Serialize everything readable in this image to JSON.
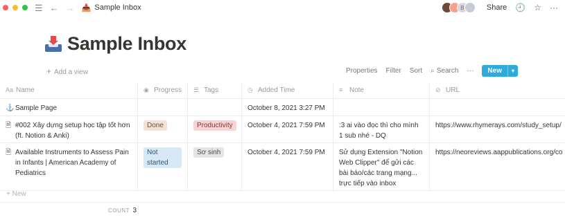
{
  "window": {
    "breadcrumb": "Sample Inbox"
  },
  "topbar": {
    "share_label": "Share",
    "avatar_initial": "B"
  },
  "page": {
    "title": "Sample Inbox"
  },
  "toolbar": {
    "add_view": "Add a view",
    "properties": "Properties",
    "filter": "Filter",
    "sort": "Sort",
    "search": "Search",
    "more": "···",
    "new_label": "New"
  },
  "table": {
    "columns": [
      "Name",
      "Progress",
      "Tags",
      "Added Time",
      "Note",
      "URL"
    ],
    "rows": [
      {
        "name": "Sample Page",
        "progress": "",
        "tag": "",
        "added": "October 8, 2021 3:27 PM",
        "note": "",
        "url": ""
      },
      {
        "name": "#002 Xây dựng setup học tập tốt hơn (ft. Notion & Anki)",
        "progress": "Done",
        "tag": "Productivity",
        "added": "October 4, 2021 7:59 PM",
        "note": ":3 ai vào đọc thì cho mình 1 sub nhé - DQ",
        "url": "https://www.rhymerays.com/study_setup/"
      },
      {
        "name": "Available Instruments to Assess Pain in Infants | American Academy of Pediatrics",
        "progress": "Not started",
        "tag": "Sơ sinh",
        "added": "October 4, 2021 7:59 PM",
        "note": "Sử dụng Extension \"Notion Web Clipper\" để gửi các bài báo/các trang mạng... trực tiếp vào inbox",
        "url": "https://neoreviews.aappublications.org/co"
      }
    ],
    "new_row": "New",
    "count_label": "COUNT",
    "count_value": "3"
  }
}
